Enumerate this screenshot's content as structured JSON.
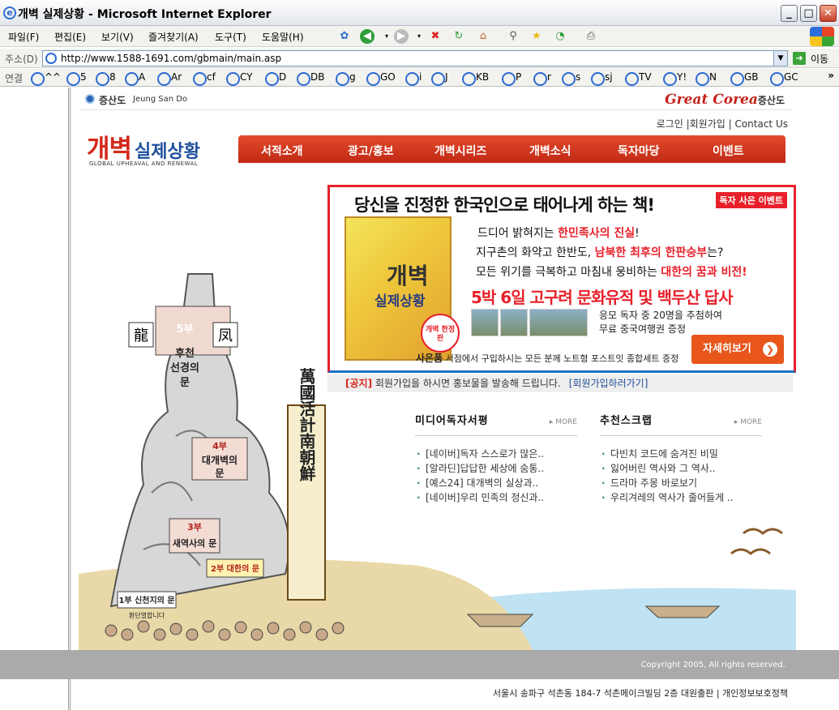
{
  "window": {
    "title": "개벽 실제상황 - Microsoft Internet Explorer",
    "minimize": "_",
    "maximize": "□",
    "close": "✕"
  },
  "menu": [
    "파일(F)",
    "편집(E)",
    "보기(V)",
    "즐겨찾기(A)",
    "도구(T)",
    "도움말(H)"
  ],
  "address": {
    "label": "주소(D)",
    "url": "http://www.1588-1691.com/gbmain/main.asp",
    "go": "이동"
  },
  "links": {
    "label": "연결",
    "items": [
      "^^",
      "5",
      "8",
      "A",
      "Ar",
      "cf",
      "CY",
      "D",
      "DB",
      "g",
      "GO",
      "i",
      "J",
      "KB",
      "P",
      "r",
      "s",
      "sj",
      "TV",
      "Y!",
      "N",
      "GB",
      "GC"
    ],
    "more": "»"
  },
  "site": {
    "brand_ko": "증산도",
    "brand_en": "Jeung San Do",
    "great_corea": "Great Corea",
    "great_corea_jsd": "증산도",
    "logo_main": "개벽",
    "logo_sub": "실제상황",
    "logo_en": "GLOBAL UPHEAVAL AND RENEWAL",
    "top_links": "로그인 |회원가입 | Contact Us",
    "nav": [
      "서적소개",
      "광고/홍보",
      "개벽시리즈",
      "개벽소식",
      "독자마당",
      "이벤트"
    ]
  },
  "banner": {
    "headline": "당신을 진정한 한국인으로 태어나게 하는 책!",
    "event_badge": "독자 사은 이벤트",
    "book_title": "개벽",
    "book_subtitle": "실제상황",
    "book_seal": "개벽 한정판",
    "line1_pre": "드디어 밝혀지는 ",
    "line1_red": "한민족사의 진실",
    "line1_post": "!",
    "line2_pre": "지구촌의 화약고 한반도, ",
    "line2_red": "남북한 최후의 한판승부",
    "line2_post": "는?",
    "line3_pre": "모든 위기를 극복하고 마침내 웅비하는 ",
    "line3_red": "대한의 꿈과 비전!",
    "trip": "5박 6일 고구려 문화유적 및 백두산 답사",
    "raffle1": "응모 독자 중 20명을 추첨하여",
    "raffle2": "무료 중국여행권 증정",
    "gift_bold": "사은품",
    "gift": " 서점에서 구입하시는 모든 분께 노트형 포스트잇 종합세트 증정",
    "more_button": "자세히보기"
  },
  "notice": {
    "tag": "[공지]",
    "text": " 회원가입을 하시면 홍보물을 발송해 드립니다.",
    "link": "[회원가입하러가기]"
  },
  "media_reviews": {
    "title": "미디어독자서평",
    "more": "▸ MORE",
    "items": [
      "[네이버]독자 스스로가 많은..",
      "[알라딘]답답한 세상에 숨통..",
      "[예스24] 대개벽의 실상과..",
      "[네이버]우리 민족의 정신과.."
    ]
  },
  "recommended": {
    "title": "추천스크랩",
    "more": "▸ MORE",
    "items": [
      "다빈치 코드에 숨겨진 비밀",
      " 잃어버린 역사와 그 역사..",
      "드라마 주몽 바로보기",
      "우리겨레의 역사가 줄어들게 .."
    ]
  },
  "illustration": {
    "dragon": "龍",
    "phoenix": "凤",
    "gate5": [
      "5부",
      "후천",
      "선경의",
      "문"
    ],
    "gate4": [
      "4부",
      "대개벽의",
      "문"
    ],
    "gate3": [
      "3부",
      "새역사의 문"
    ],
    "gate2": "2부 대한의 문",
    "gate1": "1부 신천지의 문",
    "gate1_sub": "환단열합니다",
    "banner_text": "萬國活計南朝鮮"
  },
  "footer": {
    "copyright": "Copyright 2005, All rights reserved.",
    "address": "서울시 송파구 석촌동 184-7 석촌메이크빌딩 2층 대원출판 | 개인정보보호정책"
  },
  "colors": {
    "brand_red": "#d4291c",
    "nav_red": "#c12914",
    "brand_blue": "#1e4f9c",
    "footer_gray": "#aaaaaa"
  }
}
